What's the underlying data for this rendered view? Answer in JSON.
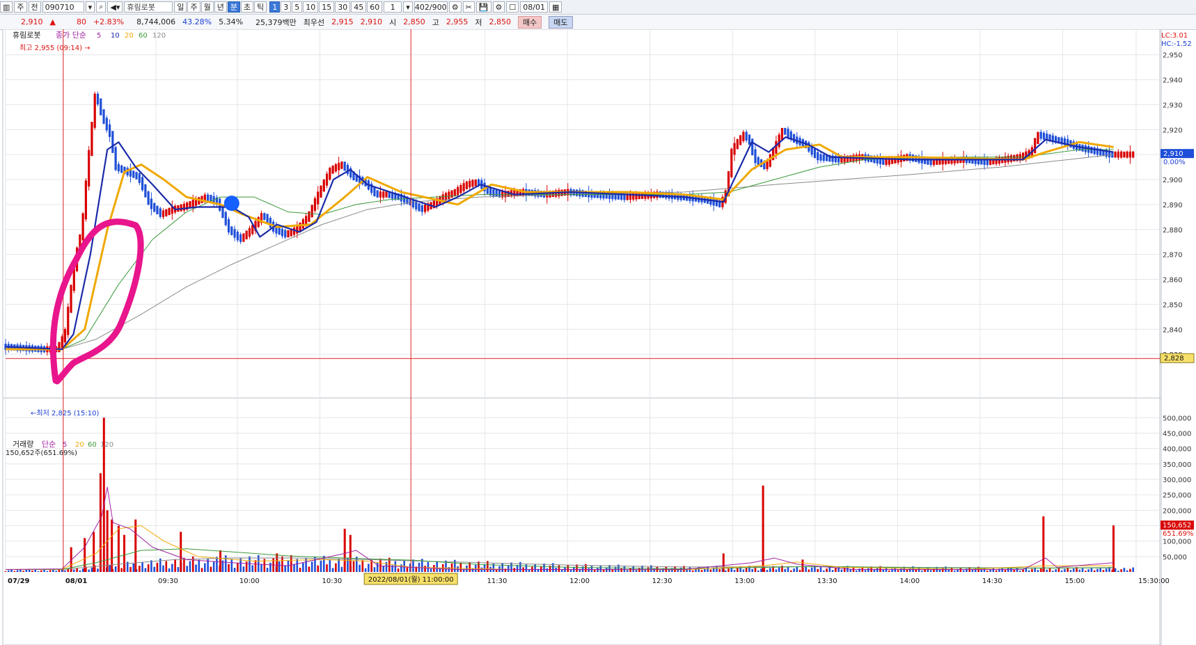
{
  "toolbar": {
    "market": "주",
    "prev": "전",
    "code": "090710",
    "stock_name": "휴림로봇",
    "periods": [
      "일",
      "주",
      "월",
      "년",
      "분",
      "초",
      "틱"
    ],
    "selected_period": "분",
    "intervals": [
      "1",
      "3",
      "5",
      "10",
      "15",
      "30",
      "45",
      "60"
    ],
    "selected_interval": "1",
    "interval_field": "1",
    "count": "402",
    "count_max": "/900",
    "date": "08/01"
  },
  "quote": {
    "price": "2,910",
    "change": "80",
    "change_pct": "+2.83%",
    "volume": "8,744,006",
    "pct1": "43.28%",
    "pct2": "5.34%",
    "amount": "25,379백만",
    "best_label": "최우선",
    "ask": "2,915",
    "bid": "2,910",
    "open_label": "시",
    "open": "2,850",
    "high_label": "고",
    "high": "2,955",
    "low_label": "저",
    "low": "2,850",
    "buy": "매수",
    "sell": "매도"
  },
  "colors": {
    "up": "#d90000",
    "down": "#1f4fd8",
    "ma5": "#1a2aa8",
    "ma20": "#f0a800",
    "ma60": "#3b9a3b",
    "ma120": "#8a8a8a",
    "highlight": "#e8158c",
    "marker": "#1560ff"
  },
  "chart_data": [
    {
      "type": "candlestick",
      "legend": {
        "name": "휴림로봇",
        "price_label": "종가",
        "ma_label": "단순",
        "periods": [
          "5",
          "10",
          "20",
          "60",
          "120"
        ]
      },
      "ylim": [
        2820,
        2958
      ],
      "y_ticks": [
        2830,
        2840,
        2850,
        2860,
        2870,
        2880,
        2890,
        2900,
        2910,
        2920,
        2930,
        2940,
        2950
      ],
      "y_tick_labels": [
        "2,830",
        "2,840",
        "2,850",
        "2,860",
        "2,870",
        "2,880",
        "2,890",
        "2,900",
        "2,910",
        "2,920",
        "2,930",
        "2,940",
        "2,950"
      ],
      "right_labels": {
        "lc": "LC:3.01",
        "hc": "HC:-1.52",
        "last": "2,910",
        "last_pct": "0.00%",
        "ref": "2,828"
      },
      "annotations": {
        "high": "최고 2,955 (09:14)",
        "low": "최저 2,825 (15:10)"
      },
      "x_ticks": [
        {
          "t": "07/29",
          "pos": 0
        },
        {
          "t": "08/01",
          "pos": 0.051
        },
        {
          "t": "09:30",
          "pos": 0.133
        },
        {
          "t": "10:00",
          "pos": 0.205
        },
        {
          "t": "10:30",
          "pos": 0.278
        },
        {
          "t": "11:30",
          "pos": 0.424
        },
        {
          "t": "12:00",
          "pos": 0.497
        },
        {
          "t": "12:30",
          "pos": 0.57
        },
        {
          "t": "13:00",
          "pos": 0.643
        },
        {
          "t": "13:30",
          "pos": 0.716
        },
        {
          "t": "14:00",
          "pos": 0.789
        },
        {
          "t": "14:30",
          "pos": 0.862
        },
        {
          "t": "15:00",
          "pos": 0.935
        },
        {
          "t": "15:30:00",
          "pos": 1.0
        }
      ],
      "crosshair_label": "2022/08/01(월) 11:00:00",
      "close_path": [
        [
          0,
          2833
        ],
        [
          0.035,
          2832
        ],
        [
          0.048,
          2832
        ],
        [
          0.055,
          2838
        ],
        [
          0.06,
          2855
        ],
        [
          0.065,
          2870
        ],
        [
          0.07,
          2880
        ],
        [
          0.075,
          2905
        ],
        [
          0.082,
          2935
        ],
        [
          0.088,
          2925
        ],
        [
          0.095,
          2918
        ],
        [
          0.1,
          2905
        ],
        [
          0.11,
          2903
        ],
        [
          0.12,
          2901
        ],
        [
          0.13,
          2890
        ],
        [
          0.14,
          2886
        ],
        [
          0.15,
          2888
        ],
        [
          0.16,
          2889
        ],
        [
          0.17,
          2891
        ],
        [
          0.18,
          2893
        ],
        [
          0.19,
          2891
        ],
        [
          0.2,
          2880
        ],
        [
          0.21,
          2876
        ],
        [
          0.22,
          2880
        ],
        [
          0.23,
          2886
        ],
        [
          0.24,
          2880
        ],
        [
          0.25,
          2878
        ],
        [
          0.26,
          2880
        ],
        [
          0.27,
          2885
        ],
        [
          0.28,
          2895
        ],
        [
          0.29,
          2904
        ],
        [
          0.3,
          2906
        ],
        [
          0.31,
          2901
        ],
        [
          0.32,
          2899
        ],
        [
          0.33,
          2894
        ],
        [
          0.34,
          2894
        ],
        [
          0.35,
          2893
        ],
        [
          0.36,
          2891
        ],
        [
          0.37,
          2888
        ],
        [
          0.38,
          2890
        ],
        [
          0.39,
          2893
        ],
        [
          0.4,
          2895
        ],
        [
          0.41,
          2898
        ],
        [
          0.42,
          2899
        ],
        [
          0.43,
          2895
        ],
        [
          0.44,
          2894
        ],
        [
          0.46,
          2895
        ],
        [
          0.48,
          2894
        ],
        [
          0.5,
          2895
        ],
        [
          0.52,
          2894
        ],
        [
          0.55,
          2893
        ],
        [
          0.58,
          2894
        ],
        [
          0.6,
          2893
        ],
        [
          0.62,
          2892
        ],
        [
          0.635,
          2890
        ],
        [
          0.64,
          2895
        ],
        [
          0.645,
          2912
        ],
        [
          0.655,
          2918
        ],
        [
          0.66,
          2916
        ],
        [
          0.665,
          2908
        ],
        [
          0.675,
          2905
        ],
        [
          0.69,
          2920
        ],
        [
          0.7,
          2916
        ],
        [
          0.71,
          2914
        ],
        [
          0.72,
          2909
        ],
        [
          0.74,
          2908
        ],
        [
          0.76,
          2909
        ],
        [
          0.78,
          2907
        ],
        [
          0.8,
          2909
        ],
        [
          0.82,
          2907
        ],
        [
          0.85,
          2908
        ],
        [
          0.87,
          2907
        ],
        [
          0.9,
          2909
        ],
        [
          0.91,
          2911
        ],
        [
          0.915,
          2918
        ],
        [
          0.93,
          2916
        ],
        [
          0.94,
          2915
        ],
        [
          0.95,
          2913
        ],
        [
          0.96,
          2912
        ],
        [
          0.97,
          2911
        ],
        [
          0.98,
          2910
        ]
      ],
      "ma5": [
        [
          0,
          2833
        ],
        [
          0.05,
          2832
        ],
        [
          0.06,
          2838
        ],
        [
          0.075,
          2870
        ],
        [
          0.09,
          2912
        ],
        [
          0.1,
          2915
        ],
        [
          0.115,
          2905
        ],
        [
          0.13,
          2898
        ],
        [
          0.15,
          2888
        ],
        [
          0.17,
          2889
        ],
        [
          0.2,
          2889
        ],
        [
          0.215,
          2885
        ],
        [
          0.225,
          2877
        ],
        [
          0.24,
          2882
        ],
        [
          0.26,
          2879
        ],
        [
          0.275,
          2883
        ],
        [
          0.29,
          2900
        ],
        [
          0.305,
          2904
        ],
        [
          0.32,
          2898
        ],
        [
          0.34,
          2895
        ],
        [
          0.36,
          2892
        ],
        [
          0.38,
          2889
        ],
        [
          0.4,
          2893
        ],
        [
          0.42,
          2898
        ],
        [
          0.45,
          2894
        ],
        [
          0.5,
          2895
        ],
        [
          0.55,
          2894
        ],
        [
          0.6,
          2893
        ],
        [
          0.635,
          2891
        ],
        [
          0.66,
          2915
        ],
        [
          0.675,
          2911
        ],
        [
          0.69,
          2917
        ],
        [
          0.71,
          2914
        ],
        [
          0.73,
          2909
        ],
        [
          0.8,
          2908
        ],
        [
          0.9,
          2908
        ],
        [
          0.92,
          2916
        ],
        [
          0.95,
          2913
        ],
        [
          0.98,
          2911
        ]
      ],
      "ma20": [
        [
          0,
          2832
        ],
        [
          0.05,
          2832
        ],
        [
          0.07,
          2840
        ],
        [
          0.09,
          2880
        ],
        [
          0.105,
          2903
        ],
        [
          0.12,
          2906
        ],
        [
          0.14,
          2900
        ],
        [
          0.16,
          2893
        ],
        [
          0.19,
          2890
        ],
        [
          0.21,
          2886
        ],
        [
          0.24,
          2881
        ],
        [
          0.27,
          2882
        ],
        [
          0.3,
          2893
        ],
        [
          0.32,
          2901
        ],
        [
          0.35,
          2895
        ],
        [
          0.38,
          2892
        ],
        [
          0.4,
          2890
        ],
        [
          0.43,
          2898
        ],
        [
          0.46,
          2895
        ],
        [
          0.5,
          2895
        ],
        [
          0.55,
          2895
        ],
        [
          0.6,
          2894
        ],
        [
          0.635,
          2892
        ],
        [
          0.66,
          2904
        ],
        [
          0.69,
          2912
        ],
        [
          0.72,
          2914
        ],
        [
          0.74,
          2909
        ],
        [
          0.8,
          2909
        ],
        [
          0.9,
          2908
        ],
        [
          0.92,
          2911
        ],
        [
          0.95,
          2915
        ],
        [
          0.98,
          2913
        ]
      ],
      "ma60": [
        [
          0,
          2832
        ],
        [
          0.05,
          2832
        ],
        [
          0.07,
          2836
        ],
        [
          0.1,
          2858
        ],
        [
          0.13,
          2876
        ],
        [
          0.16,
          2887
        ],
        [
          0.19,
          2893
        ],
        [
          0.22,
          2893
        ],
        [
          0.25,
          2887
        ],
        [
          0.28,
          2886
        ],
        [
          0.31,
          2890
        ],
        [
          0.34,
          2892
        ],
        [
          0.38,
          2893
        ],
        [
          0.42,
          2894
        ],
        [
          0.5,
          2894
        ],
        [
          0.6,
          2894
        ],
        [
          0.64,
          2895
        ],
        [
          0.68,
          2900
        ],
        [
          0.72,
          2905
        ],
        [
          0.76,
          2908
        ],
        [
          0.82,
          2909
        ],
        [
          0.9,
          2909
        ],
        [
          0.95,
          2912
        ],
        [
          0.98,
          2912
        ]
      ],
      "ma120": [
        [
          0,
          2832
        ],
        [
          0.05,
          2832
        ],
        [
          0.08,
          2836
        ],
        [
          0.12,
          2846
        ],
        [
          0.16,
          2857
        ],
        [
          0.2,
          2866
        ],
        [
          0.24,
          2874
        ],
        [
          0.28,
          2882
        ],
        [
          0.32,
          2888
        ],
        [
          0.36,
          2891
        ],
        [
          0.42,
          2893
        ],
        [
          0.5,
          2894
        ],
        [
          0.6,
          2895
        ],
        [
          0.68,
          2898
        ],
        [
          0.74,
          2900
        ],
        [
          0.8,
          2902
        ],
        [
          0.88,
          2905
        ],
        [
          0.94,
          2908
        ],
        [
          0.98,
          2910
        ]
      ]
    },
    {
      "type": "bar",
      "legend": {
        "name": "거래량",
        "ma_label": "단순",
        "periods": [
          "5",
          "20",
          "60",
          "120"
        ]
      },
      "current": "150,652주(651.69%)",
      "ylim": [
        0,
        530000
      ],
      "y_ticks": [
        50000,
        100000,
        150000,
        200000,
        250000,
        300000,
        350000,
        400000,
        450000,
        500000
      ],
      "y_tick_labels": [
        "50,000",
        "100,000",
        "150,000",
        "200,000",
        "250,000",
        "300,000",
        "350,000",
        "400,000",
        "450,000",
        "500,000"
      ],
      "right_labels": {
        "last": "150,652",
        "last_pct": "651.69%"
      },
      "spikes": [
        {
          "x": 0.087,
          "v": 500000
        },
        {
          "x": 0.084,
          "v": 320000
        },
        {
          "x": 0.09,
          "v": 200000
        },
        {
          "x": 0.094,
          "v": 170000
        },
        {
          "x": 0.1,
          "v": 150000
        },
        {
          "x": 0.105,
          "v": 120000
        },
        {
          "x": 0.115,
          "v": 170000
        },
        {
          "x": 0.078,
          "v": 130000
        },
        {
          "x": 0.07,
          "v": 110000
        },
        {
          "x": 0.058,
          "v": 80000
        },
        {
          "x": 0.155,
          "v": 130000
        },
        {
          "x": 0.19,
          "v": 70000
        },
        {
          "x": 0.24,
          "v": 60000
        },
        {
          "x": 0.3,
          "v": 140000
        },
        {
          "x": 0.305,
          "v": 120000
        },
        {
          "x": 0.635,
          "v": 60000
        },
        {
          "x": 0.67,
          "v": 280000
        },
        {
          "x": 0.705,
          "v": 40000
        },
        {
          "x": 0.918,
          "v": 180000
        },
        {
          "x": 0.98,
          "v": 150652
        }
      ],
      "ma5": [
        [
          0,
          8000
        ],
        [
          0.05,
          10000
        ],
        [
          0.07,
          80000
        ],
        [
          0.085,
          180000
        ],
        [
          0.09,
          275000
        ],
        [
          0.095,
          160000
        ],
        [
          0.11,
          140000
        ],
        [
          0.13,
          80000
        ],
        [
          0.16,
          40000
        ],
        [
          0.2,
          30000
        ],
        [
          0.25,
          20000
        ],
        [
          0.3,
          60000
        ],
        [
          0.31,
          70000
        ],
        [
          0.33,
          20000
        ],
        [
          0.4,
          8000
        ],
        [
          0.6,
          8000
        ],
        [
          0.66,
          30000
        ],
        [
          0.68,
          45000
        ],
        [
          0.7,
          25000
        ],
        [
          0.75,
          8000
        ],
        [
          0.9,
          8000
        ],
        [
          0.92,
          45000
        ],
        [
          0.93,
          15000
        ],
        [
          0.98,
          30000
        ]
      ],
      "ma20": [
        [
          0,
          8000
        ],
        [
          0.05,
          9000
        ],
        [
          0.08,
          60000
        ],
        [
          0.1,
          140000
        ],
        [
          0.12,
          150000
        ],
        [
          0.14,
          100000
        ],
        [
          0.17,
          50000
        ],
        [
          0.22,
          35000
        ],
        [
          0.28,
          40000
        ],
        [
          0.32,
          35000
        ],
        [
          0.36,
          15000
        ],
        [
          0.45,
          8000
        ],
        [
          0.6,
          7000
        ],
        [
          0.67,
          20000
        ],
        [
          0.7,
          32000
        ],
        [
          0.74,
          15000
        ],
        [
          0.85,
          8000
        ],
        [
          0.92,
          20000
        ],
        [
          0.98,
          20000
        ]
      ],
      "ma60": [
        [
          0,
          8000
        ],
        [
          0.05,
          8000
        ],
        [
          0.08,
          30000
        ],
        [
          0.12,
          70000
        ],
        [
          0.16,
          75000
        ],
        [
          0.2,
          65000
        ],
        [
          0.25,
          52000
        ],
        [
          0.3,
          45000
        ],
        [
          0.36,
          38000
        ],
        [
          0.42,
          24000
        ],
        [
          0.5,
          15000
        ],
        [
          0.6,
          10000
        ],
        [
          0.66,
          14000
        ],
        [
          0.72,
          18000
        ],
        [
          0.8,
          14000
        ],
        [
          0.9,
          12000
        ],
        [
          0.98,
          14000
        ]
      ],
      "ma120": [
        [
          0,
          8000
        ],
        [
          0.05,
          8000
        ],
        [
          0.1,
          25000
        ],
        [
          0.15,
          40000
        ],
        [
          0.2,
          45000
        ],
        [
          0.26,
          45000
        ],
        [
          0.32,
          40000
        ],
        [
          0.4,
          32000
        ],
        [
          0.5,
          22000
        ],
        [
          0.6,
          16000
        ],
        [
          0.7,
          17000
        ],
        [
          0.8,
          15000
        ],
        [
          0.9,
          13000
        ],
        [
          0.98,
          13000
        ]
      ]
    }
  ]
}
